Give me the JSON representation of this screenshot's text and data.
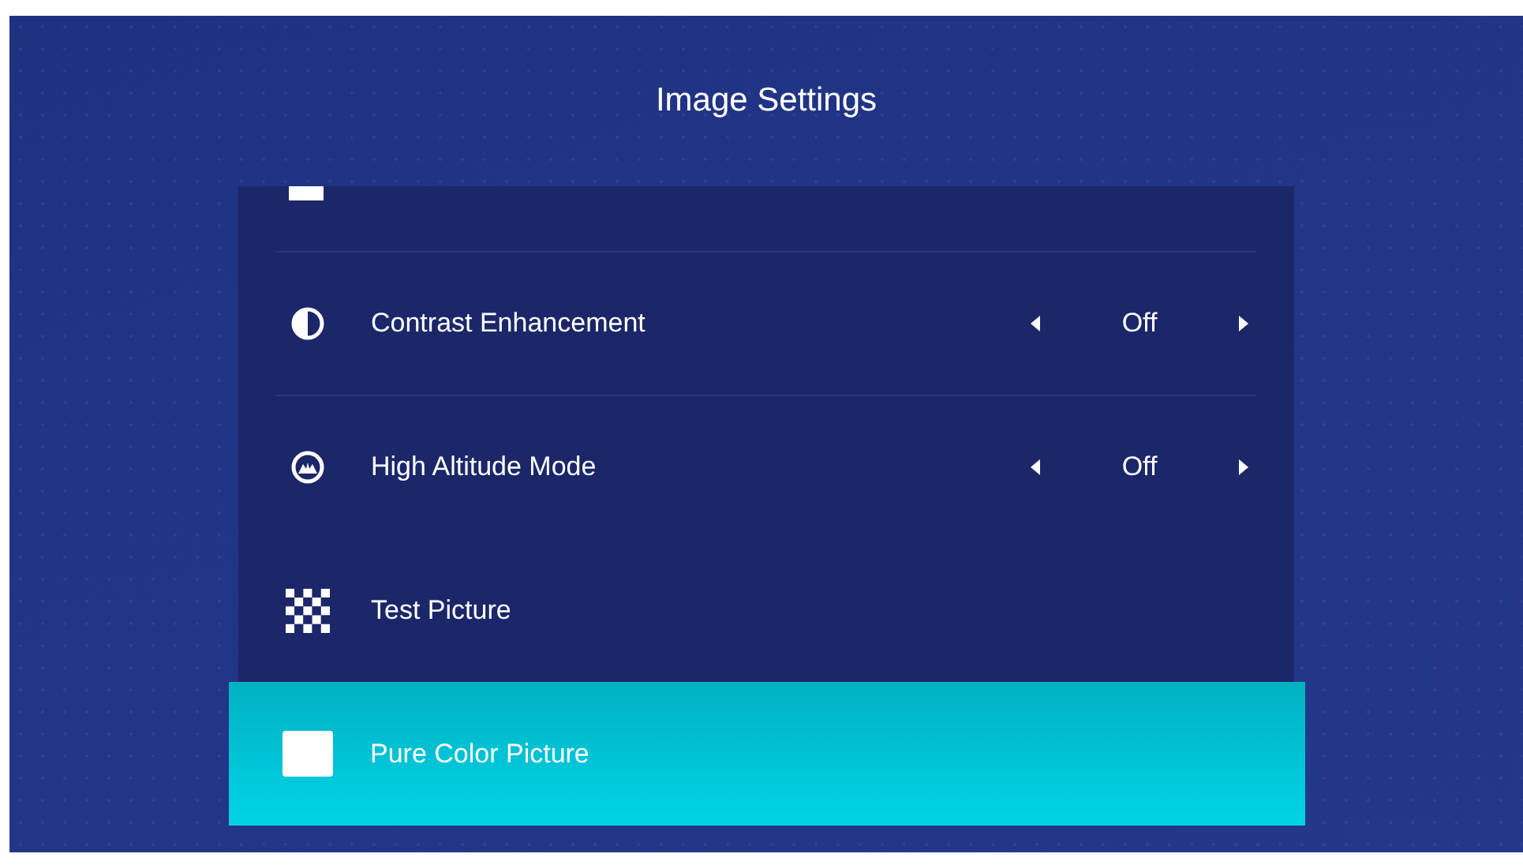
{
  "title": "Image Settings",
  "items": [
    {
      "label": "Contrast Enhancement",
      "kind": "option",
      "value": "Off",
      "selected": false
    },
    {
      "label": "High Altitude Mode",
      "kind": "option",
      "value": "Off",
      "selected": false
    },
    {
      "label": "Test Picture",
      "kind": "action",
      "selected": false
    },
    {
      "label": "Pure Color Picture",
      "kind": "action",
      "selected": true
    }
  ]
}
